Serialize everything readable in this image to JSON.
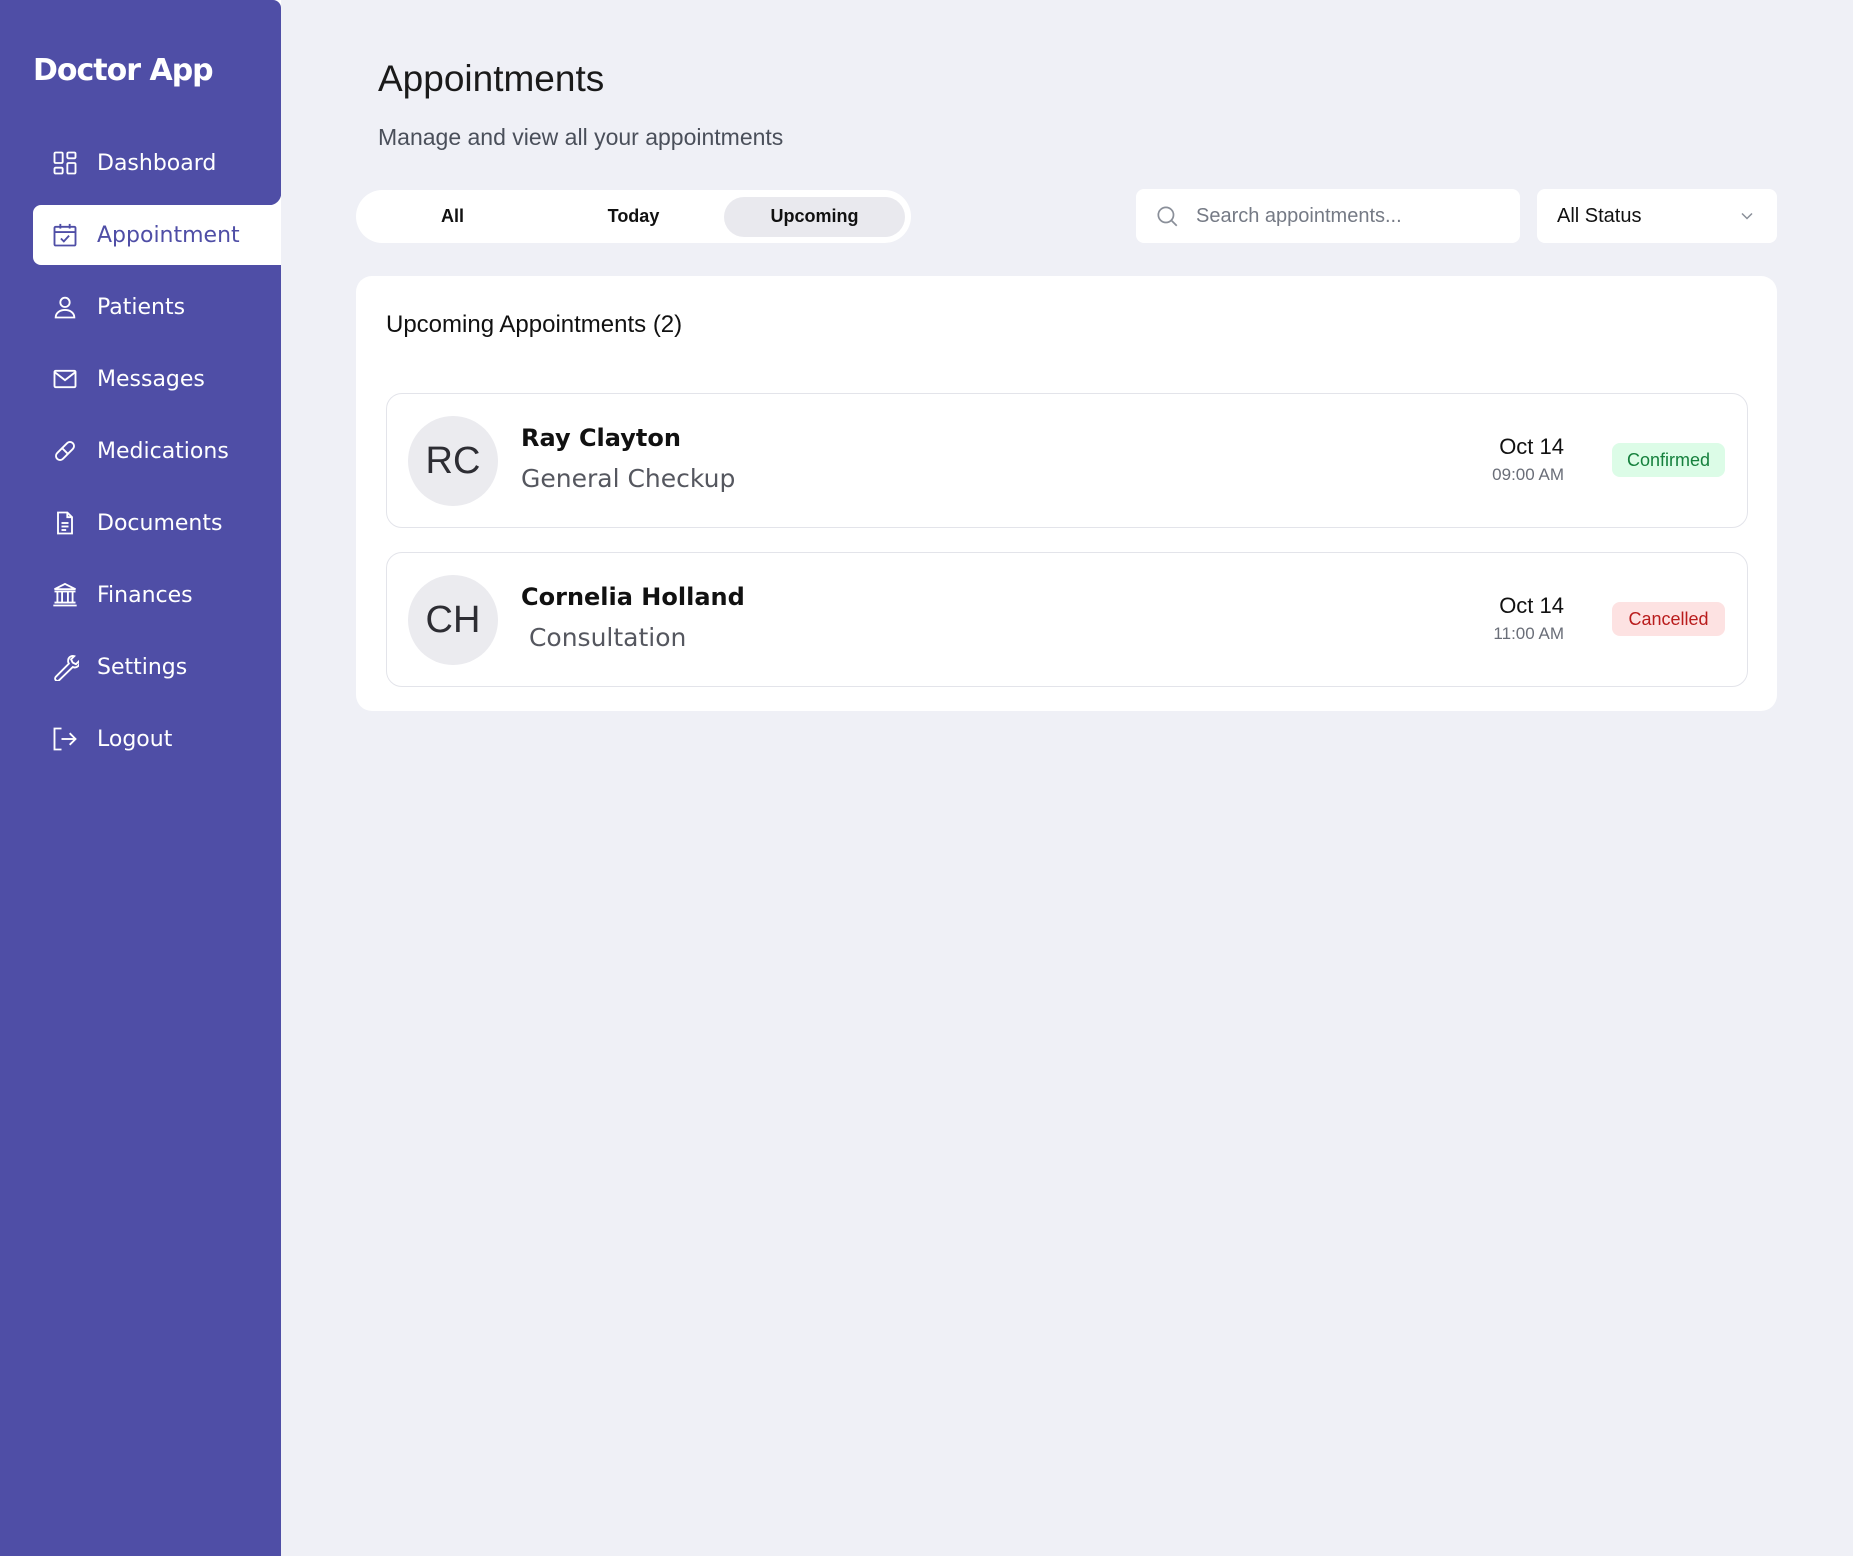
{
  "sidebar": {
    "brand": "Doctor App",
    "items": [
      {
        "label": "Dashboard",
        "icon": "dashboard-icon"
      },
      {
        "label": "Appointment",
        "icon": "calendar-check-icon",
        "active": true
      },
      {
        "label": "Patients",
        "icon": "user-icon"
      },
      {
        "label": "Messages",
        "icon": "mail-icon"
      },
      {
        "label": "Medications",
        "icon": "pill-icon"
      },
      {
        "label": "Documents",
        "icon": "document-icon"
      },
      {
        "label": "Finances",
        "icon": "bank-icon"
      },
      {
        "label": "Settings",
        "icon": "wrench-icon"
      },
      {
        "label": "Logout",
        "icon": "logout-icon"
      }
    ]
  },
  "header": {
    "title": "Appointments",
    "subtitle": "Manage and view all your appointments"
  },
  "tabs": [
    {
      "label": "All"
    },
    {
      "label": "Today"
    },
    {
      "label": "Upcoming",
      "active": true
    }
  ],
  "search": {
    "placeholder": "Search appointments...",
    "value": ""
  },
  "status_filter": {
    "selected": "All Status"
  },
  "list": {
    "title": "Upcoming Appointments (2)",
    "appointments": [
      {
        "initials": "RC",
        "name": "Ray Clayton",
        "type": "General Checkup",
        "date": "Oct 14",
        "time": "09:00 AM",
        "status": "Confirmed"
      },
      {
        "initials": "CH",
        "name": "Cornelia Holland",
        "type": " Consultation",
        "date": "Oct 14",
        "time": "11:00 AM",
        "status": "Cancelled"
      }
    ]
  },
  "colors": {
    "sidebar_bg": "#4f4ea6",
    "main_bg": "#eff0f6",
    "confirmed_bg": "#dcfce7",
    "confirmed_text": "#15803d",
    "cancelled_bg": "#fde2e2",
    "cancelled_text": "#b91c1c"
  }
}
